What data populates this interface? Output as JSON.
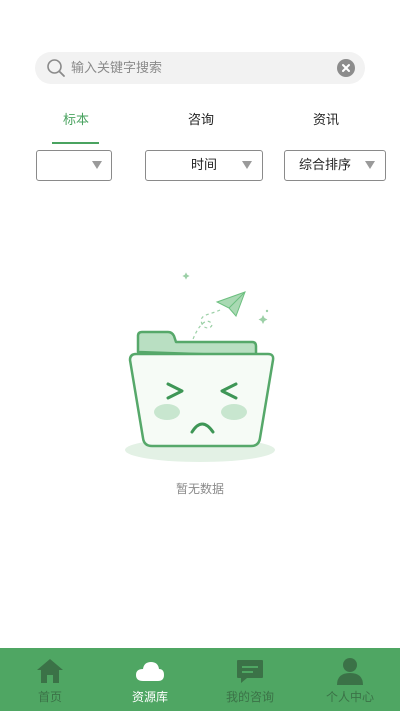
{
  "search": {
    "placeholder": "输入关键字搜索",
    "value": "",
    "icon": "search-icon",
    "clear_icon": "clear-icon"
  },
  "tabs": [
    {
      "label": "标本",
      "active": true
    },
    {
      "label": "咨询",
      "active": false
    },
    {
      "label": "资讯",
      "active": false
    }
  ],
  "filters": [
    {
      "label": "",
      "icon": "dropdown-arrow-icon"
    },
    {
      "label": "时间",
      "icon": "dropdown-arrow-icon"
    },
    {
      "label": "综合排序",
      "icon": "dropdown-arrow-icon"
    }
  ],
  "empty_state": {
    "message": "暂无数据",
    "icon": "empty-folder-illustration"
  },
  "tabbar": [
    {
      "label": "首页",
      "icon": "home-icon",
      "active": false
    },
    {
      "label": "资源库",
      "icon": "cloud-icon",
      "active": true
    },
    {
      "label": "我的咨询",
      "icon": "chat-icon",
      "active": false
    },
    {
      "label": "个人中心",
      "icon": "user-icon",
      "active": false
    }
  ],
  "colors": {
    "accent": "#4aa360",
    "tabbar_bg": "#4fa663",
    "tabbar_inactive": "#3b7247",
    "tabbar_active": "#ffffff",
    "muted_text": "#8a8a8a"
  }
}
